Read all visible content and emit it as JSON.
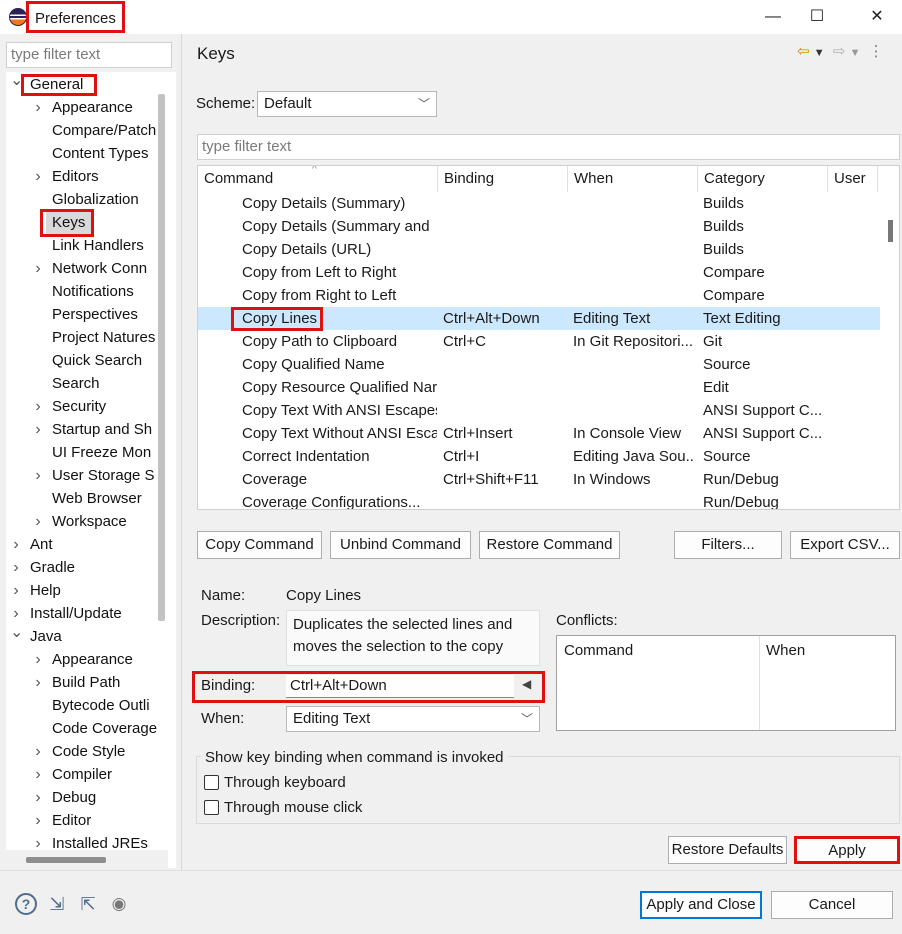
{
  "window": {
    "title": "Preferences",
    "minimize": "—",
    "maximize": "☐",
    "close": "✕"
  },
  "left": {
    "filter_placeholder": "type filter text",
    "tree": [
      {
        "label": "General",
        "level": 0,
        "arrow": "expanded"
      },
      {
        "label": "Appearance",
        "level": 1,
        "arrow": "collapsed"
      },
      {
        "label": "Compare/Patch",
        "level": 1,
        "arrow": "none"
      },
      {
        "label": "Content Types",
        "level": 1,
        "arrow": "none"
      },
      {
        "label": "Editors",
        "level": 1,
        "arrow": "collapsed"
      },
      {
        "label": "Globalization",
        "level": 1,
        "arrow": "none"
      },
      {
        "label": "Keys",
        "level": 1,
        "arrow": "none"
      },
      {
        "label": "Link Handlers",
        "level": 1,
        "arrow": "none"
      },
      {
        "label": "Network Conn",
        "level": 1,
        "arrow": "collapsed"
      },
      {
        "label": "Notifications",
        "level": 1,
        "arrow": "none"
      },
      {
        "label": "Perspectives",
        "level": 1,
        "arrow": "none"
      },
      {
        "label": "Project Natures",
        "level": 1,
        "arrow": "none"
      },
      {
        "label": "Quick Search",
        "level": 1,
        "arrow": "none"
      },
      {
        "label": "Search",
        "level": 1,
        "arrow": "none"
      },
      {
        "label": "Security",
        "level": 1,
        "arrow": "collapsed"
      },
      {
        "label": "Startup and Sh",
        "level": 1,
        "arrow": "collapsed"
      },
      {
        "label": "UI Freeze Mon",
        "level": 1,
        "arrow": "none"
      },
      {
        "label": "User Storage S",
        "level": 1,
        "arrow": "collapsed"
      },
      {
        "label": "Web Browser",
        "level": 1,
        "arrow": "none"
      },
      {
        "label": "Workspace",
        "level": 1,
        "arrow": "collapsed"
      },
      {
        "label": "Ant",
        "level": 0,
        "arrow": "collapsed"
      },
      {
        "label": "Gradle",
        "level": 0,
        "arrow": "collapsed"
      },
      {
        "label": "Help",
        "level": 0,
        "arrow": "collapsed"
      },
      {
        "label": "Install/Update",
        "level": 0,
        "arrow": "collapsed"
      },
      {
        "label": "Java",
        "level": 0,
        "arrow": "expanded"
      },
      {
        "label": "Appearance",
        "level": 1,
        "arrow": "collapsed"
      },
      {
        "label": "Build Path",
        "level": 1,
        "arrow": "collapsed"
      },
      {
        "label": "Bytecode Outli",
        "level": 1,
        "arrow": "none"
      },
      {
        "label": "Code Coverage",
        "level": 1,
        "arrow": "none"
      },
      {
        "label": "Code Style",
        "level": 1,
        "arrow": "collapsed"
      },
      {
        "label": "Compiler",
        "level": 1,
        "arrow": "collapsed"
      },
      {
        "label": "Debug",
        "level": 1,
        "arrow": "collapsed"
      },
      {
        "label": "Editor",
        "level": 1,
        "arrow": "collapsed"
      },
      {
        "label": "Installed JREs",
        "level": 1,
        "arrow": "collapsed"
      }
    ]
  },
  "page": {
    "title": "Keys",
    "nav_back": "⇦",
    "nav_forward": "⇨",
    "menu": "⋮",
    "scheme_label": "Scheme:",
    "scheme_value": "Default",
    "filter_placeholder": "type filter text",
    "columns": [
      "Command",
      "Binding",
      "When",
      "Category",
      "User"
    ],
    "rows": [
      {
        "command": "Copy Details (Summary)",
        "binding": "",
        "when": "",
        "category": "Builds",
        "user": ""
      },
      {
        "command": "Copy Details (Summary and",
        "binding": "",
        "when": "",
        "category": "Builds",
        "user": ""
      },
      {
        "command": "Copy Details (URL)",
        "binding": "",
        "when": "",
        "category": "Builds",
        "user": ""
      },
      {
        "command": "Copy from Left to Right",
        "binding": "",
        "when": "",
        "category": "Compare",
        "user": ""
      },
      {
        "command": "Copy from Right to Left",
        "binding": "",
        "when": "",
        "category": "Compare",
        "user": ""
      },
      {
        "command": "Copy Lines",
        "binding": "Ctrl+Alt+Down",
        "when": "Editing Text",
        "category": "Text Editing",
        "user": ""
      },
      {
        "command": "Copy Path to Clipboard",
        "binding": "Ctrl+C",
        "when": "In Git Repositori...",
        "category": "Git",
        "user": ""
      },
      {
        "command": "Copy Qualified Name",
        "binding": "",
        "when": "",
        "category": "Source",
        "user": ""
      },
      {
        "command": "Copy Resource Qualified Nar",
        "binding": "",
        "when": "",
        "category": "Edit",
        "user": ""
      },
      {
        "command": "Copy Text With ANSI Escapes",
        "binding": "",
        "when": "",
        "category": "ANSI Support C...",
        "user": ""
      },
      {
        "command": "Copy Text Without ANSI Esca",
        "binding": "Ctrl+Insert",
        "when": "In Console View",
        "category": "ANSI Support C...",
        "user": ""
      },
      {
        "command": "Correct Indentation",
        "binding": "Ctrl+I",
        "when": "Editing Java Sou...",
        "category": "Source",
        "user": ""
      },
      {
        "command": "Coverage",
        "binding": "Ctrl+Shift+F11",
        "when": "In Windows",
        "category": "Run/Debug",
        "user": ""
      },
      {
        "command": "Coverage Configurations...",
        "binding": "",
        "when": "",
        "category": "Run/Debug",
        "user": ""
      }
    ],
    "buttons": {
      "copy": "Copy Command",
      "unbind": "Unbind Command",
      "restore": "Restore Command",
      "filters": "Filters...",
      "export": "Export CSV..."
    },
    "details": {
      "name_label": "Name:",
      "name_value": "Copy Lines",
      "desc_label": "Description:",
      "desc_value": "Duplicates the selected lines and moves the selection to the copy",
      "binding_label": "Binding:",
      "binding_value": "Ctrl+Alt+Down",
      "when_label": "When:",
      "when_value": "Editing Text",
      "conflicts_label": "Conflicts:",
      "conflicts_columns": [
        "Command",
        "When"
      ]
    },
    "show_binding": {
      "legend": "Show key binding when command is invoked",
      "keyboard": "Through keyboard",
      "mouse": "Through mouse click"
    },
    "restore_defaults": "Restore Defaults",
    "apply": "Apply"
  },
  "footer": {
    "apply_close": "Apply and Close",
    "cancel": "Cancel",
    "icons": [
      "help-icon",
      "import-icon",
      "export-icon",
      "record-icon"
    ]
  },
  "colors": {
    "highlight_red": "#e01010",
    "selected_row": "#cce8ff",
    "focus_blue": "#0078d7"
  }
}
